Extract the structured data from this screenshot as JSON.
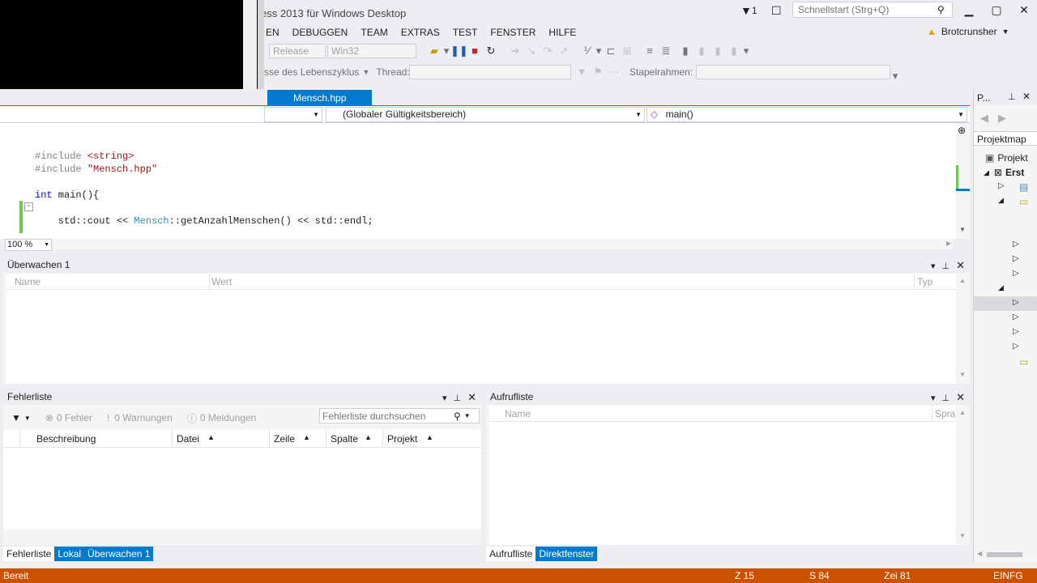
{
  "window": {
    "title": "ess 2013 für Windows Desktop",
    "notification_count": "1",
    "quick_launch_placeholder": "Schnellstart (Strg+Q)",
    "user": "Brotcrunsher"
  },
  "menu": [
    "EN",
    "DEBUGGEN",
    "TEAM",
    "EXTRAS",
    "TEST",
    "FENSTER",
    "HILFE"
  ],
  "toolbar": {
    "config": "Release",
    "platform": "Win32",
    "lifecycle_label": "sse des Lebenszyklus",
    "thread_label": "Thread:",
    "stackframe_label": "Stapelrahmen:"
  },
  "editor": {
    "tab_name": "Mensch.hpp",
    "scope_combo": "(Globaler Gültigkeitsbereich)",
    "function_combo": "main()",
    "zoom": "100 %",
    "lines": [
      {
        "parts": [
          {
            "t": "#include ",
            "c": "gray"
          },
          {
            "t": "<string>",
            "c": "str"
          }
        ]
      },
      {
        "parts": [
          {
            "t": "#include ",
            "c": "gray"
          },
          {
            "t": "\"Mensch.hpp\"",
            "c": "str"
          }
        ]
      },
      {
        "parts": []
      },
      {
        "parts": [
          {
            "t": "int",
            "c": "kw"
          },
          {
            "t": " main(){",
            "c": ""
          }
        ]
      },
      {
        "parts": []
      },
      {
        "parts": [
          {
            "t": "    std::cout << ",
            "c": ""
          },
          {
            "t": "Mensch",
            "c": "typ"
          },
          {
            "t": "::getAnzahlMenschen() << std::endl;",
            "c": ""
          }
        ]
      }
    ]
  },
  "watch": {
    "title": "Überwachen 1",
    "columns": [
      "Name",
      "Wert",
      "Typ"
    ]
  },
  "errors": {
    "title": "Fehlerliste",
    "errors_count": "0 Fehler",
    "warnings_count": "0 Warnungen",
    "messages_count": "0 Meldungen",
    "search_placeholder": "Fehlerliste durchsuchen",
    "columns": [
      "Beschreibung",
      "Datei",
      "Zeile",
      "Spalte",
      "Projekt"
    ],
    "tabs": [
      "Fehlerliste",
      "Lokal",
      "Überwachen 1"
    ]
  },
  "callstack": {
    "title": "Aufrufliste",
    "columns": [
      "Name",
      "Spra"
    ],
    "tabs": [
      "Aufrufliste",
      "Direktfenster"
    ]
  },
  "solution": {
    "title": "P...",
    "search": "Projektmap",
    "items": [
      "Projekt",
      "Erst"
    ]
  },
  "status": {
    "ready": "Bereit",
    "line": "Z 15",
    "col": "S 84",
    "char": "Zei 81",
    "mode": "EINFG"
  },
  "colors": {
    "accent": "#007ACC",
    "status_bar": "#CA5100"
  }
}
